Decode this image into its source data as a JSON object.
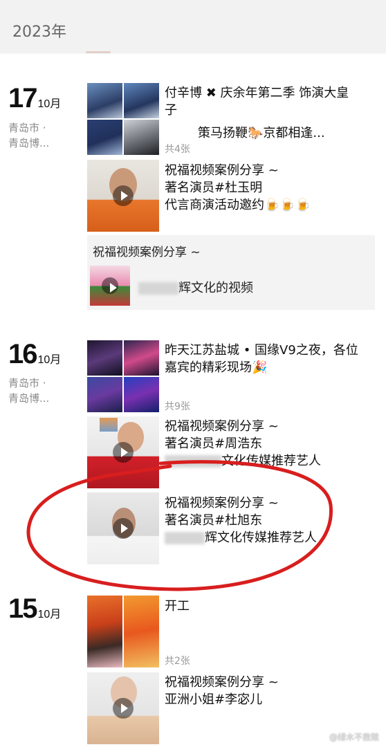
{
  "year_header": "2023年",
  "groups": [
    {
      "day": "17",
      "month": "10月",
      "location_line1": "青岛市 ·",
      "location_line2": "青岛博...",
      "posts": [
        {
          "line1": "付辛博 ✖ 庆余年第二季 饰演大皇",
          "line2": "子",
          "line3": "策马扬鞭🐎京都相逢...",
          "count": "共4张"
        },
        {
          "line1": "祝福视频案例分享 ~",
          "line2": "著名演员#杜玉明",
          "line3": "代言商演活动邀约🍺🍺🍺"
        }
      ],
      "shared": {
        "title": "祝福视频案例分享 ~",
        "caption": "辉文化的视频"
      }
    },
    {
      "day": "16",
      "month": "10月",
      "location_line1": "青岛市 ·",
      "location_line2": "青岛博...",
      "posts": [
        {
          "line1": "昨天江苏盐城 • 国缘V9之夜，各位",
          "line2": "嘉宾的精彩现场🎉",
          "count": "共9张"
        },
        {
          "line1": "祝福视频案例分享 ~",
          "line2": "著名演员#周浩东",
          "line3": "文化传媒推荐艺人"
        },
        {
          "line1": "祝福视频案例分享 ~",
          "line2": "著名演员#杜旭东",
          "line3": "辉文化传媒推荐艺人"
        }
      ]
    },
    {
      "day": "15",
      "month": "10月",
      "posts": [
        {
          "line1": "开工",
          "count": "共2张"
        },
        {
          "line1": "祝福视频案例分享 ~",
          "line2": "亚洲小姐#李宓儿"
        }
      ]
    }
  ],
  "watermark": "@绿木不救赎",
  "colors": {
    "annotation_circle": "#d81e1e",
    "background": "#ffffff",
    "header_bg": "#f2f2f2"
  }
}
